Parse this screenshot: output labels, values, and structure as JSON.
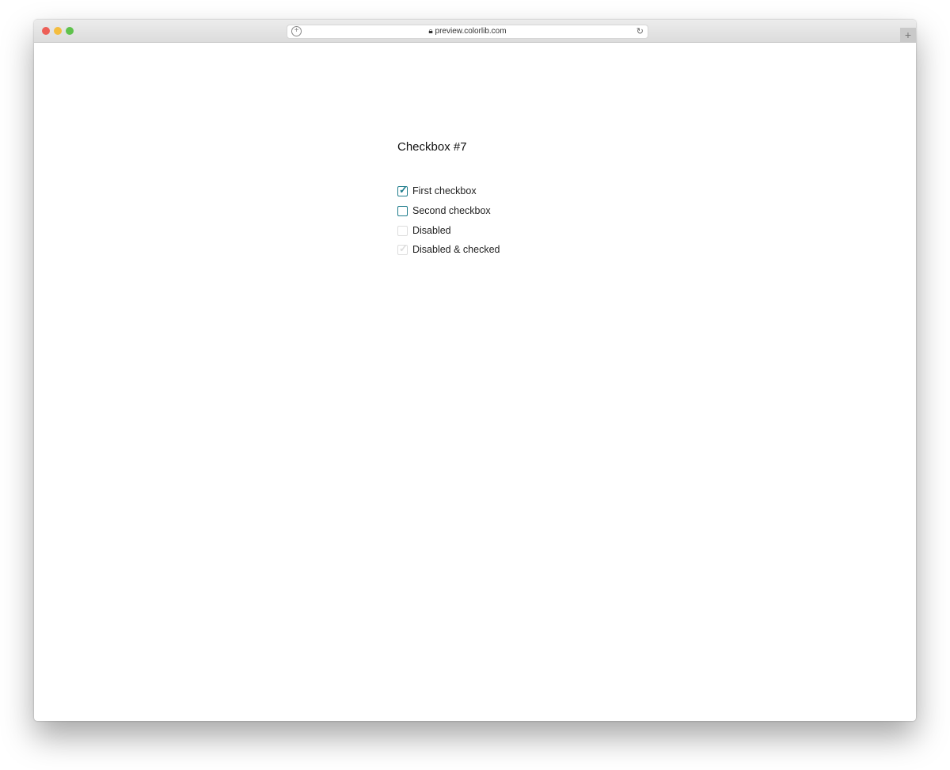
{
  "browser": {
    "url": "preview.colorlib.com"
  },
  "page": {
    "title": "Checkbox #7",
    "checkboxes": [
      {
        "label": "First checkbox",
        "checked": true,
        "disabled": false
      },
      {
        "label": "Second checkbox",
        "checked": false,
        "disabled": false
      },
      {
        "label": "Disabled",
        "checked": false,
        "disabled": true
      },
      {
        "label": "Disabled & checked",
        "checked": true,
        "disabled": true
      }
    ]
  },
  "colors": {
    "accent": "#1f7d8c",
    "disabled": "#dddddd"
  }
}
